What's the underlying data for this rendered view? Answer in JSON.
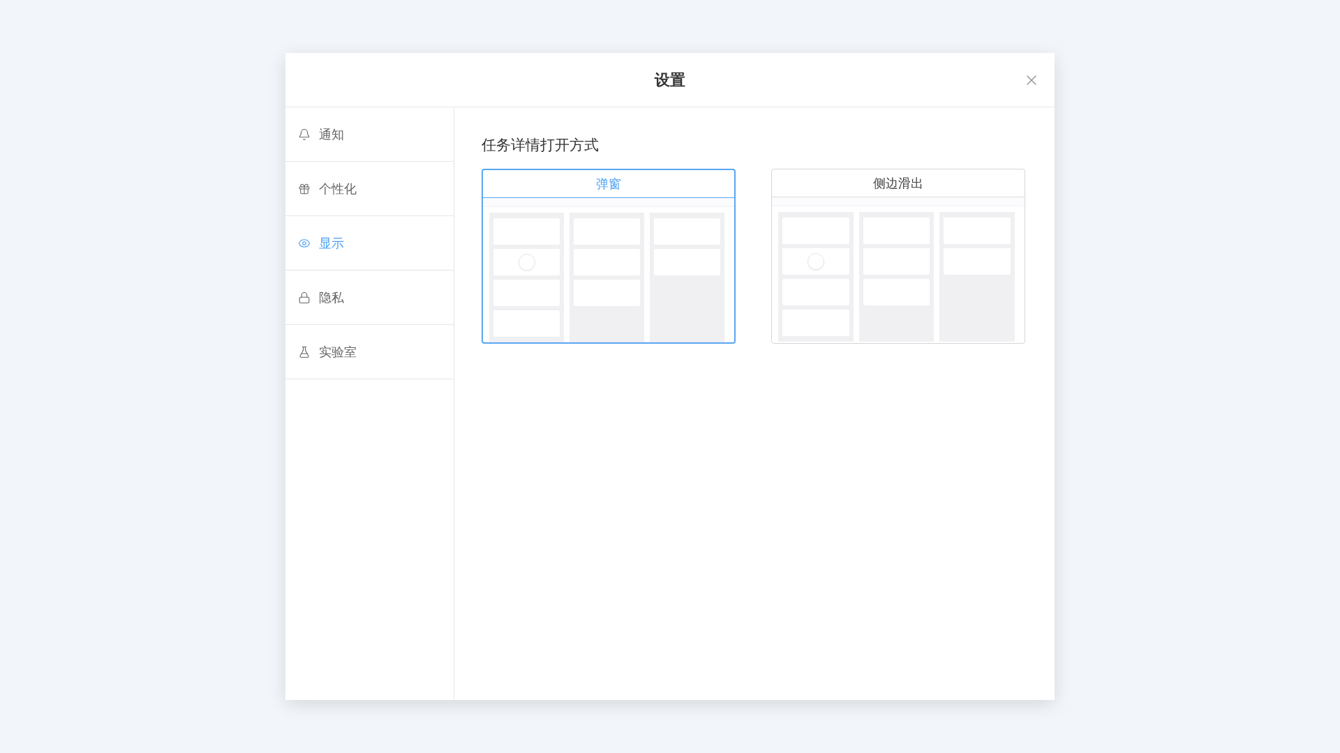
{
  "dialog": {
    "title": "设置"
  },
  "sidebar": {
    "items": [
      {
        "label": "通知",
        "selected": false
      },
      {
        "label": "个性化",
        "selected": false
      },
      {
        "label": "显示",
        "selected": true
      },
      {
        "label": "隐私",
        "selected": false
      },
      {
        "label": "实验室",
        "selected": false
      }
    ]
  },
  "section": {
    "title": "任务详情打开方式",
    "options": [
      {
        "label": "弹窗",
        "selected": true
      },
      {
        "label": "侧边滑出",
        "selected": false
      }
    ]
  }
}
